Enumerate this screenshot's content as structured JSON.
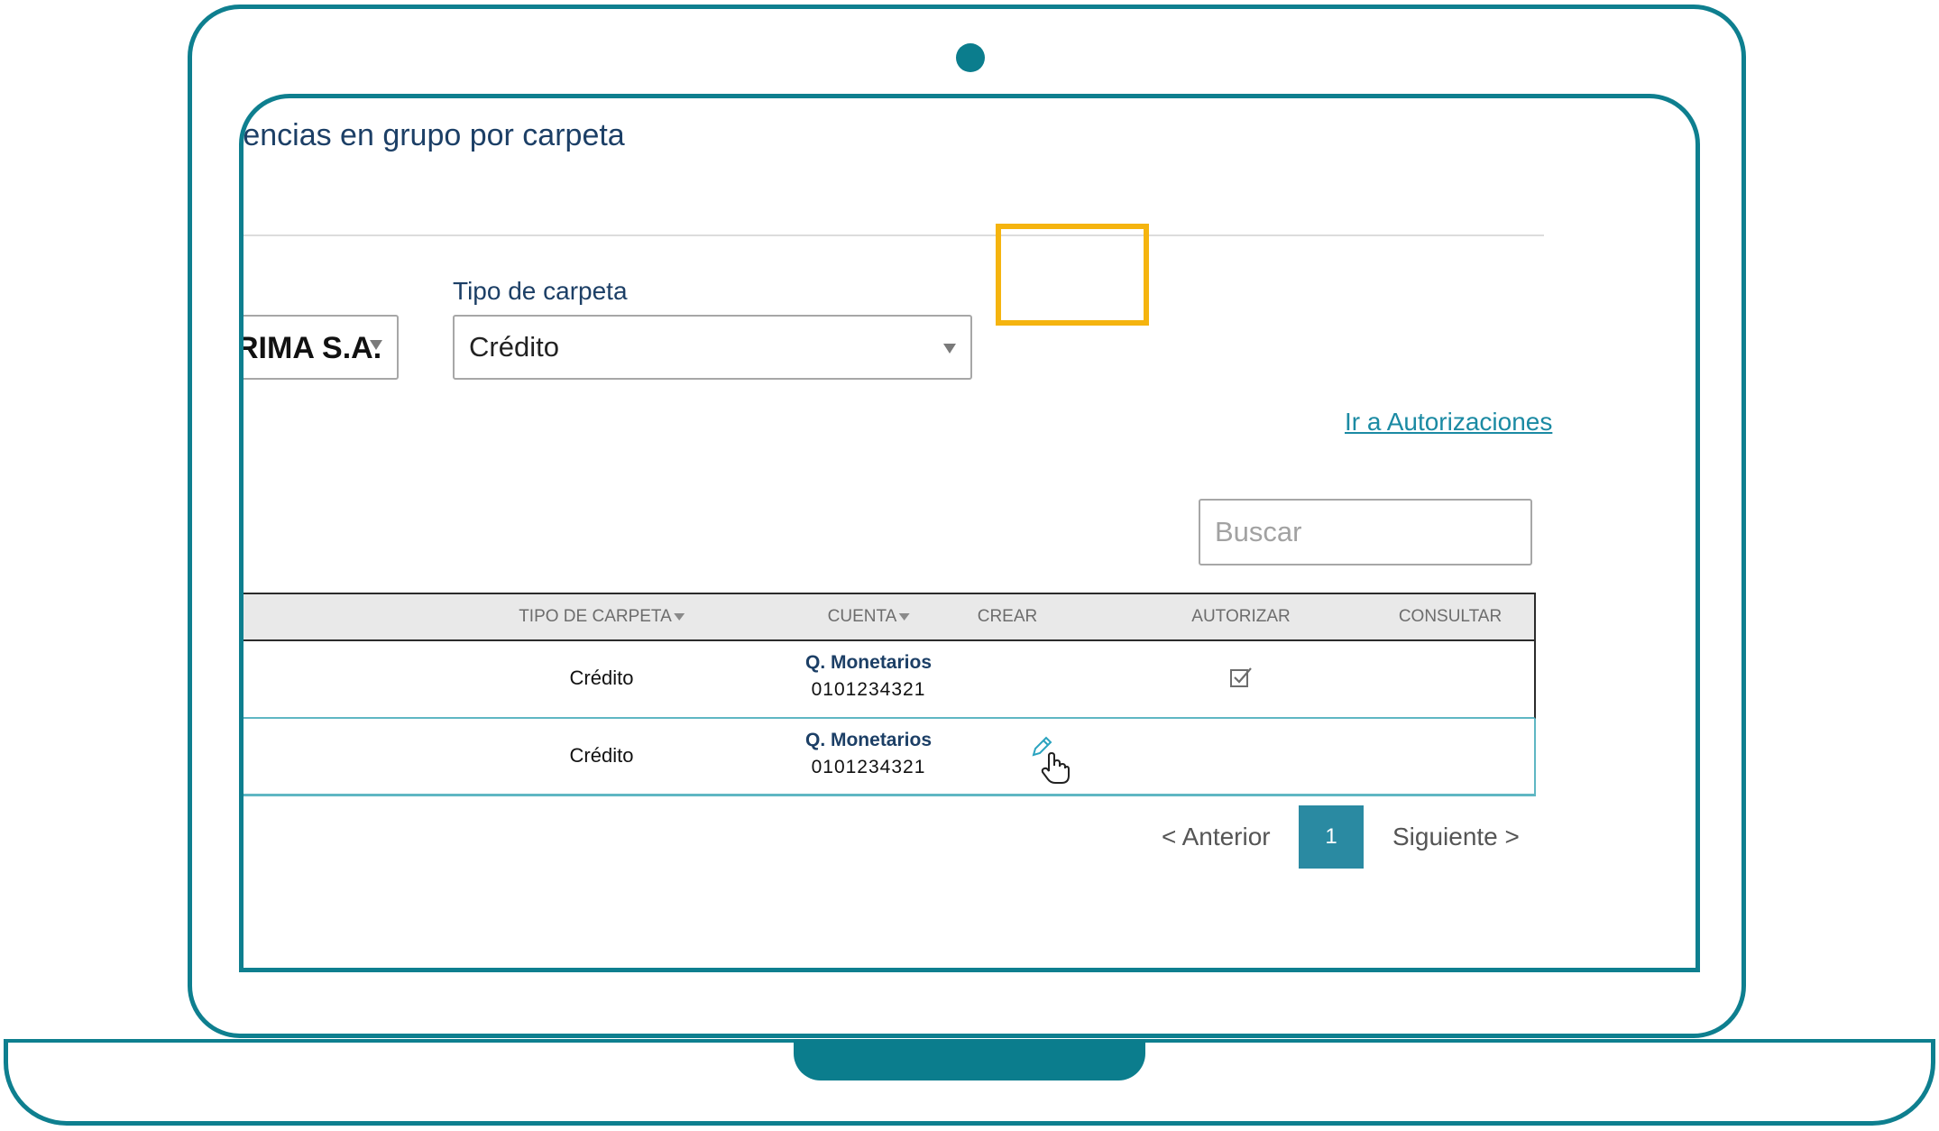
{
  "page": {
    "title": "rencias en grupo por carpeta"
  },
  "filters": {
    "company_value": "RIMA S.A.",
    "folder_type_label": "Tipo de carpeta",
    "folder_type_value": "Crédito"
  },
  "links": {
    "authorizations": "Ir a Autorizaciones"
  },
  "search": {
    "placeholder": "Buscar"
  },
  "table": {
    "columns": [
      "TIPO DE CARPETA",
      "CUENTA",
      "CREAR",
      "AUTORIZAR",
      "CONSULTAR"
    ],
    "rows": [
      {
        "folder_type": "Crédito",
        "account_type": "Q. Monetarios",
        "account_number": "0101234321",
        "action": "autorizar"
      },
      {
        "folder_type": "Crédito",
        "account_type": "Q. Monetarios",
        "account_number": "0101234321",
        "action": "crear"
      }
    ]
  },
  "pagination": {
    "previous": "< Anterior",
    "current": "1",
    "next": "Siguiente >"
  },
  "icons": {
    "camera": "camera-dot",
    "check": "checkbox-check-icon",
    "edit": "pencil-icon",
    "cursor": "hand-pointer-icon",
    "sort": "sort-down-icon"
  },
  "colors": {
    "frame": "#0e7f8f",
    "title": "#1c3f66",
    "link": "#1b8aa3",
    "active_page": "#2a8aa2",
    "highlight": "#f5b40f"
  }
}
